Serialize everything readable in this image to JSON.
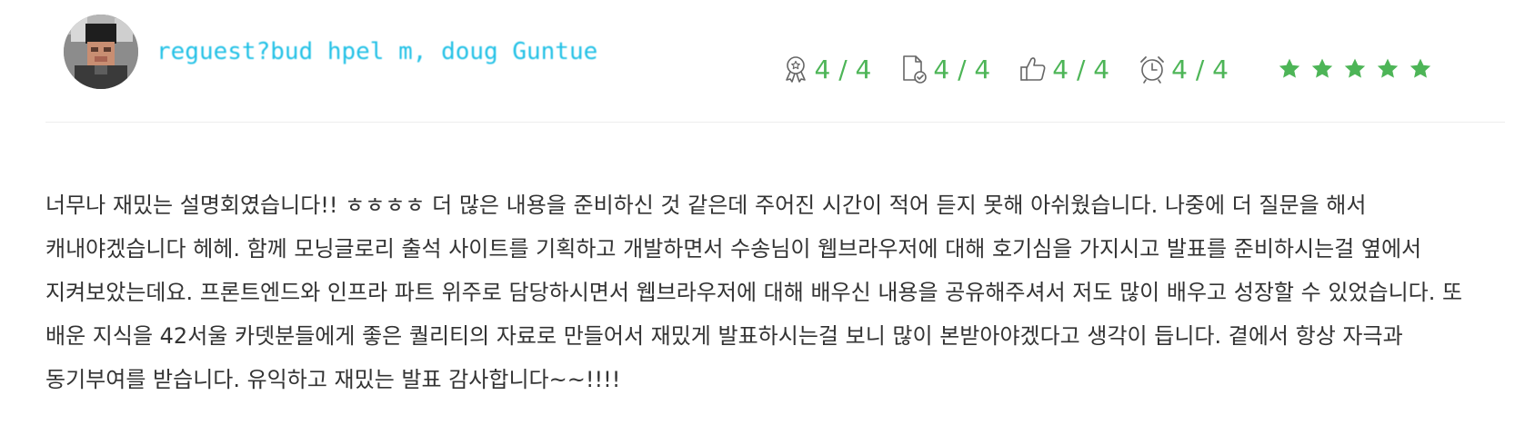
{
  "review": {
    "reviewer_name": "reguest?bud hpel m, doug Guntue",
    "metrics": [
      {
        "icon": "award-ribbon-icon",
        "value": "4 / 4"
      },
      {
        "icon": "document-check-icon",
        "value": "4 / 4"
      },
      {
        "icon": "thumbs-up-icon",
        "value": "4 / 4"
      },
      {
        "icon": "alarm-clock-icon",
        "value": "4 / 4"
      }
    ],
    "rating": 5,
    "rating_max": 5,
    "colors": {
      "accent_green": "#4db557",
      "name_blue": "#22c1e6",
      "divider": "#eeeeee",
      "text": "#333333"
    },
    "body_text": "너무나 재밌는 설명회였습니다!! ㅎㅎㅎㅎ 더 많은 내용을 준비하신 것 같은데 주어진 시간이 적어 듣지 못해 아쉬웠습니다. 나중에 더 질문을 해서 캐내야겠습니다 헤헤. 함께 모닝글로리 출석 사이트를 기획하고 개발하면서 수송님이 웹브라우저에 대해 호기심을 가지시고 발표를 준비하시는걸 옆에서 지켜보았는데요. 프론트엔드와 인프라 파트 위주로 담당하시면서 웹브라우저에 대해 배우신 내용을 공유해주셔서 저도 많이 배우고 성장할 수 있었습니다. 또 배운 지식을 42서울 카뎃분들에게 좋은 퀄리티의 자료로 만들어서 재밌게 발표하시는걸 보니 많이 본받아야겠다고 생각이 듭니다. 곁에서 항상 자극과 동기부여를 받습니다. 유익하고 재밌는 발표 감사합니다~~!!!!"
  }
}
